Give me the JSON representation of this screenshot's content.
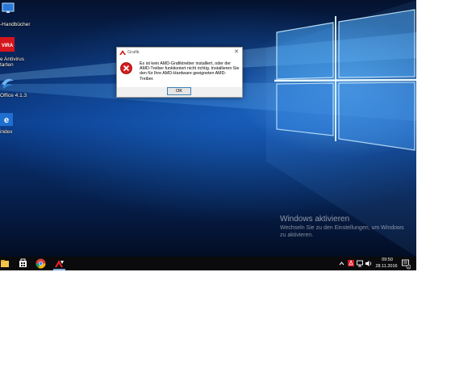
{
  "desktop": {
    "icons": [
      {
        "label": "-Handbücher",
        "icon": "monitor-icon"
      },
      {
        "label": "e Antivirus",
        "label2": "tarten",
        "icon": "avira-icon"
      },
      {
        "label": "Office 4.1.3",
        "icon": "openoffice-icon"
      },
      {
        "label": "index",
        "icon": "edge-icon"
      }
    ],
    "watermark": {
      "title": "Windows aktivieren",
      "line1": "Wechseln Sie zu den Einstellungen, um Windows",
      "line2": "zu aktivieren."
    }
  },
  "dialog": {
    "title": "Grafik",
    "message": "Es ist kein AMD-Grafiktreiber installiert, oder der AMD-Treiber funktioniert nicht richtig. Installieren Sie den für Ihre AMD-Hardware geeigneten AMD-Treiber.",
    "ok_label": "OK",
    "close_symbol": "✕",
    "icon": "error-icon"
  },
  "taskbar": {
    "pinned": [
      "file-explorer-icon",
      "store-icon",
      "chrome-icon",
      "amd-icon"
    ],
    "tray": {
      "icons": [
        "chevron-up-icon",
        "avira-tray-icon",
        "network-icon",
        "volume-icon",
        "action-center-icon"
      ],
      "time": "09:50",
      "date": "28.11.2016",
      "notification_count": "2"
    }
  },
  "colors": {
    "accent": "#e81123",
    "taskbar": "#0b0b0d",
    "wallpaper_blue": "#0c3f8f"
  }
}
